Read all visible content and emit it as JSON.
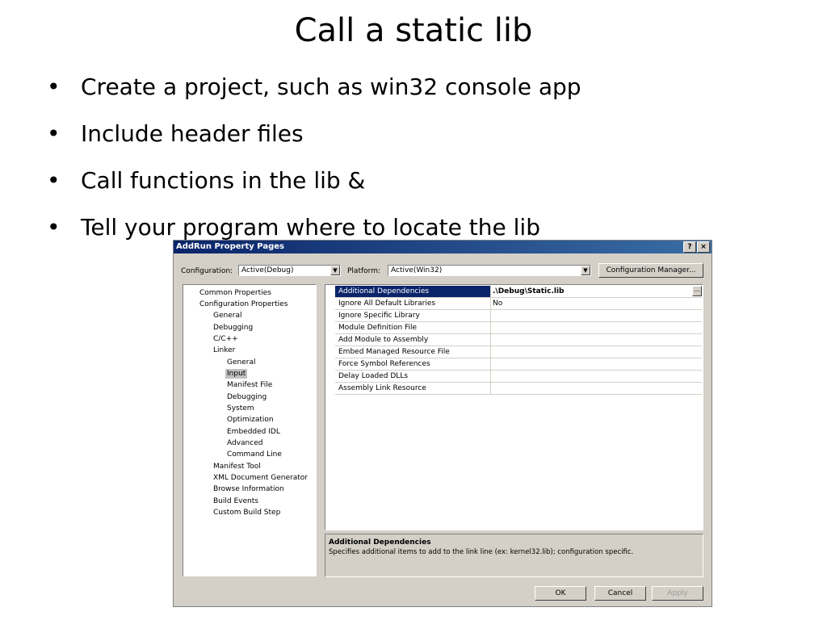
{
  "slide": {
    "title": "Call a static lib",
    "bullet_glyph": "•",
    "bullets": [
      "Create a project, such as win32 console app",
      "Include header files",
      "Call functions in the lib &",
      "Tell your program where to locate the lib"
    ]
  },
  "dialog": {
    "title": "AddRun Property Pages",
    "help_btn": "?",
    "close_btn": "×",
    "config_label": "Configuration:",
    "config_value": "Active(Debug)",
    "platform_label": "Platform:",
    "platform_value": "Active(Win32)",
    "config_manager_btn": "Configuration Manager...",
    "tree": [
      "Common Properties",
      "Configuration Properties",
      "General",
      "Debugging",
      "C/C++",
      "Linker",
      "General",
      "Input",
      "Manifest File",
      "Debugging",
      "System",
      "Optimization",
      "Embedded IDL",
      "Advanced",
      "Command Line",
      "Manifest Tool",
      "XML Document Generator",
      "Browse Information",
      "Build Events",
      "Custom Build Step"
    ],
    "selected_tree_item": "Input",
    "properties": [
      {
        "name": "Additional Dependencies",
        "value": ".\\Debug\\Static.lib"
      },
      {
        "name": "Ignore All Default Libraries",
        "value": "No"
      },
      {
        "name": "Ignore Specific Library",
        "value": ""
      },
      {
        "name": "Module Definition File",
        "value": ""
      },
      {
        "name": "Add Module to Assembly",
        "value": ""
      },
      {
        "name": "Embed Managed Resource File",
        "value": ""
      },
      {
        "name": "Force Symbol References",
        "value": ""
      },
      {
        "name": "Delay Loaded DLLs",
        "value": ""
      },
      {
        "name": "Assembly Link Resource",
        "value": ""
      }
    ],
    "ellipsis_btn": "...",
    "desc_title": "Additional Dependencies",
    "desc_text": "Specifies additional items to add to the link line (ex: kernel32.lib); configuration specific.",
    "ok_btn": "OK",
    "cancel_btn": "Cancel",
    "apply_btn": "Apply"
  }
}
